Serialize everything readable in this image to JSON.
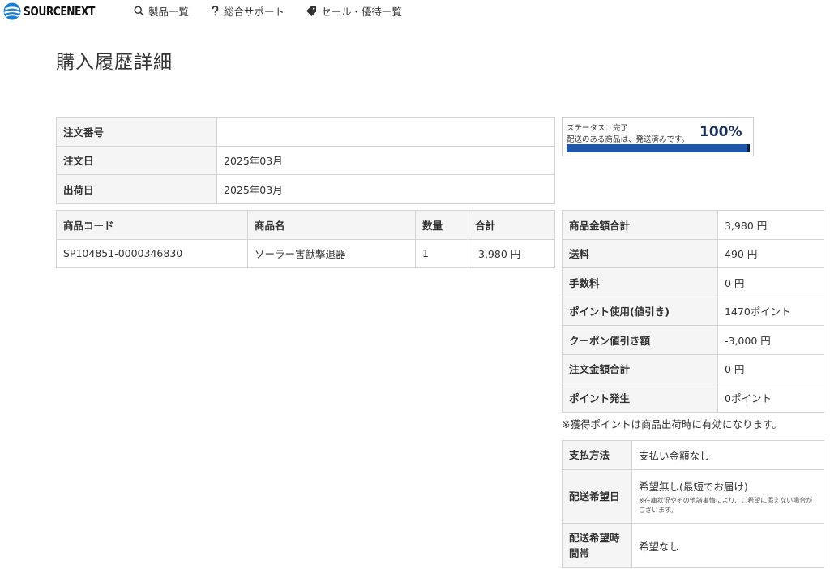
{
  "header": {
    "logo_text": "SOURCENEXT",
    "nav": [
      {
        "label": "製品一覧",
        "icon": "search-icon"
      },
      {
        "label": "総合サポート",
        "icon": "question-icon"
      },
      {
        "label": "セール・優待一覧",
        "icon": "tag-icon"
      }
    ]
  },
  "page_title": "購入履歴詳細",
  "order_info": {
    "rows": [
      {
        "label": "注文番号",
        "value": ""
      },
      {
        "label": "注文日",
        "value": "2025年03月"
      },
      {
        "label": "出荷日",
        "value": "2025年03月"
      }
    ]
  },
  "items_table": {
    "headers": [
      "商品コード",
      "商品名",
      "数量",
      "合計"
    ],
    "rows": [
      {
        "code": "SP104851-0000346830",
        "name": "ソーラー害獣撃退器",
        "qty": "1",
        "total": "3,980 円"
      }
    ]
  },
  "status": {
    "line1": "ステータス：完了",
    "line2": "配送のある商品は、発送済みです。",
    "percent_label": "100%",
    "progress_fraction": 1.0,
    "bar_color": "#1f56a8"
  },
  "totals": {
    "rows": [
      {
        "label": "商品金額合計",
        "value": "3,980 円"
      },
      {
        "label": "送料",
        "value": "490 円"
      },
      {
        "label": "手数料",
        "value": "0 円"
      },
      {
        "label": "ポイント使用(値引き)",
        "value": "1470ポイント"
      },
      {
        "label": "クーポン値引き額",
        "value": "-3,000 円"
      },
      {
        "label": "注文金額合計",
        "value": "0 円"
      },
      {
        "label": "ポイント発生",
        "value": "0ポイント"
      }
    ],
    "note": "※獲得ポイントは商品出荷時に有効になります。"
  },
  "payment": {
    "method_label": "支払方法",
    "method_value": "支払い金額なし",
    "delivery_date_label": "配送希望日",
    "delivery_date_value": "希望無し(最短でお届け)",
    "delivery_date_note": "※在庫状況やその他諸事情により、ご希望に添えない場合がございます。",
    "delivery_time_label": "配送希望時間帯",
    "delivery_time_value": "希望なし"
  }
}
